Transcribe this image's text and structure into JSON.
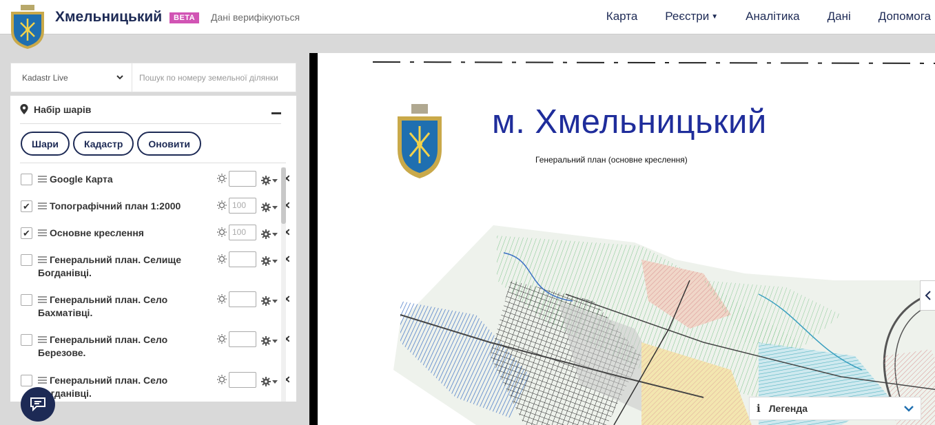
{
  "header": {
    "brand": "Хмельницький",
    "beta": "BETA",
    "status": "Дані верифікуються",
    "nav": [
      {
        "label": "Карта",
        "dropdown": false
      },
      {
        "label": "Реєстри",
        "dropdown": true
      },
      {
        "label": "Аналітика",
        "dropdown": false
      },
      {
        "label": "Дані",
        "dropdown": false
      },
      {
        "label": "Допомога",
        "dropdown": false
      }
    ]
  },
  "search": {
    "source": "Kadastr Live",
    "placeholder": "Пошук по номеру земельної ділянки"
  },
  "layers_panel": {
    "title": "Набір шарів",
    "buttons": {
      "layers": "Шари",
      "cadastre": "Кадастр",
      "refresh": "Оновити"
    },
    "items": [
      {
        "name": "Google Карта",
        "checked": false,
        "opacity": ""
      },
      {
        "name": "Топографічний план 1:2000",
        "checked": true,
        "opacity": "100"
      },
      {
        "name": "Основне креслення",
        "checked": true,
        "opacity": "100"
      },
      {
        "name": "Генеральний план. Селище Богданівці.",
        "checked": false,
        "opacity": ""
      },
      {
        "name": "Генеральний план. Село Бахматівці.",
        "checked": false,
        "opacity": ""
      },
      {
        "name": "Генеральний план. Село Березове.",
        "checked": false,
        "opacity": ""
      },
      {
        "name": "Генеральний план. Село Богданівці.",
        "checked": false,
        "opacity": ""
      }
    ]
  },
  "map": {
    "title": "м. Хмельницький",
    "subtitle": "Генеральний план (основне креслення)"
  },
  "legend": {
    "label": "Легенда"
  },
  "colors": {
    "brand": "#1d2a55",
    "beta": "#d154b4",
    "map_title": "#1f2d9b"
  }
}
